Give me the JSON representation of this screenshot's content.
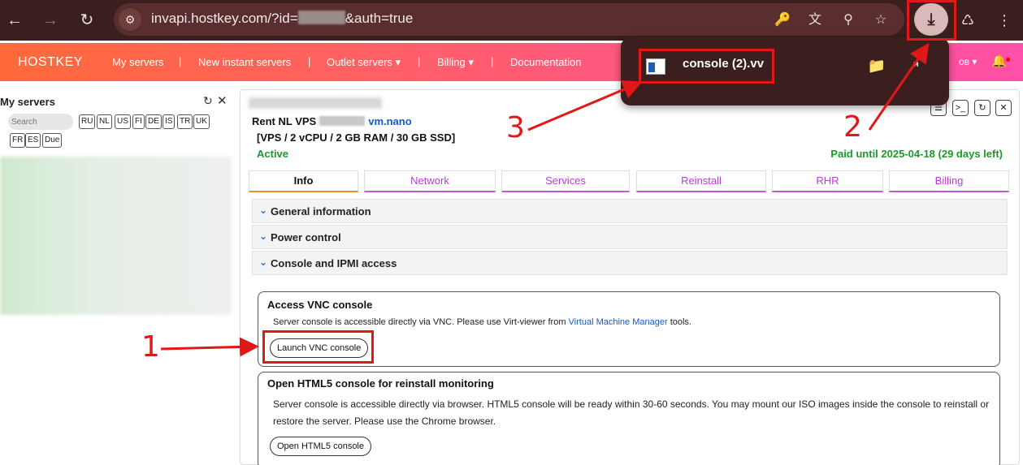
{
  "browser": {
    "url_prefix": "invapi.hostkey.com/?id=",
    "url_suffix": "&auth=true",
    "icons": [
      "back-arrow-icon",
      "forward-arrow-icon",
      "reload-icon",
      "site-info-icon",
      "key-icon",
      "translate-icon",
      "zoom-icon",
      "star-icon",
      "download-icon",
      "extension-icon",
      "menu-icon"
    ]
  },
  "header": {
    "logo": "HOSTKEY",
    "nav": [
      "My servers",
      "New instant servers",
      "Outlet servers",
      "Billing",
      "Documentation"
    ],
    "separator": "|",
    "user_fragment": "ов"
  },
  "download_popup": {
    "file_name": "console (2).vv"
  },
  "sidebar": {
    "title": "My servers",
    "search_placeholder": "Search",
    "filters": [
      "RU",
      "NL",
      "US",
      "FI",
      "DE",
      "IS",
      "TR",
      "UK",
      "FR",
      "ES",
      "Due"
    ]
  },
  "server": {
    "title_prefix": "Rent NL VPS",
    "plan": "vm.nano",
    "spec": "[VPS / 2 vCPU / 2 GB RAM / 30 GB SSD]",
    "status": "Active",
    "paid_until": "Paid until 2025-04-18 (29 days left)"
  },
  "tabs": [
    "Info",
    "Network",
    "Services",
    "Reinstall",
    "RHR",
    "Billing"
  ],
  "sections": [
    "General information",
    "Power control",
    "Console and IPMI access"
  ],
  "vnc_card": {
    "title": "Access VNC console",
    "text_before": "Server console is accessible directly via VNC. Please use Virt-viewer from ",
    "link": "Virtual Machine Manager",
    "text_after": " tools.",
    "button": "Launch VNC console"
  },
  "html5_card": {
    "title": "Open HTML5 console for reinstall monitoring",
    "text": "Server console is accessible directly via browser. HTML5 console will be ready within 30-60 seconds. You may mount our ISO images inside the console to reinstall or restore the server. Please use the Chrome browser.",
    "button": "Open HTML5 console"
  },
  "annotations": {
    "step1": "1",
    "step2": "2",
    "step3": "3"
  },
  "colors": {
    "annotation": "#e01818",
    "status_green": "#1a9a2a",
    "tab_purple": "#b63fd0",
    "link_blue": "#1459c8"
  }
}
